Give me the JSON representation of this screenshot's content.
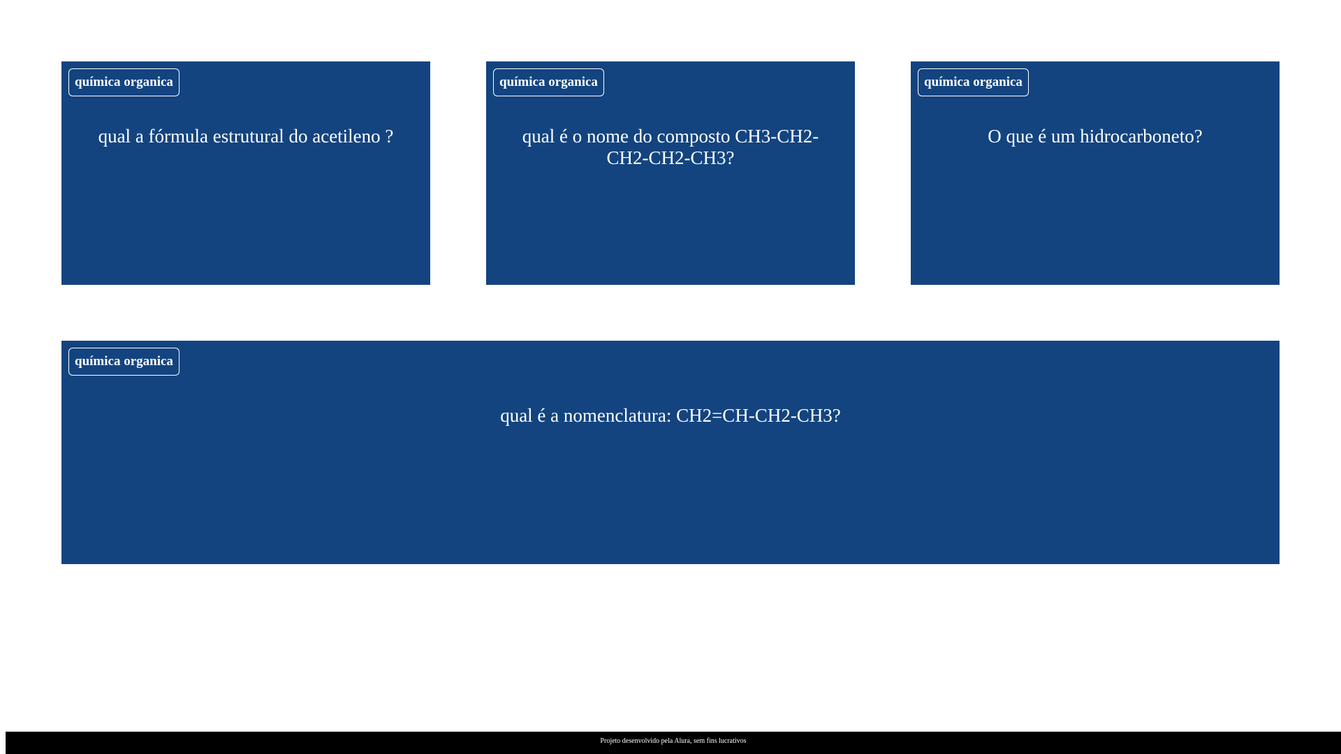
{
  "cards": [
    {
      "tag": "química organica",
      "question": "qual a fórmula estrutural do acetileno ?"
    },
    {
      "tag": "química organica",
      "question": "qual é o nome do composto CH3-CH2-CH2-CH2-CH3?"
    },
    {
      "tag": "química organica",
      "question": "O que é um hidrocarboneto?"
    },
    {
      "tag": "química organica",
      "question": "qual é a nomenclatura: CH2=CH-CH2-CH3?"
    }
  ],
  "footer": {
    "text": "Projeto desenvolvido pela Alura, sem fins lucrativos"
  },
  "colors": {
    "card_background": "#134480",
    "card_text": "#ffffff",
    "footer_background": "#000000"
  }
}
